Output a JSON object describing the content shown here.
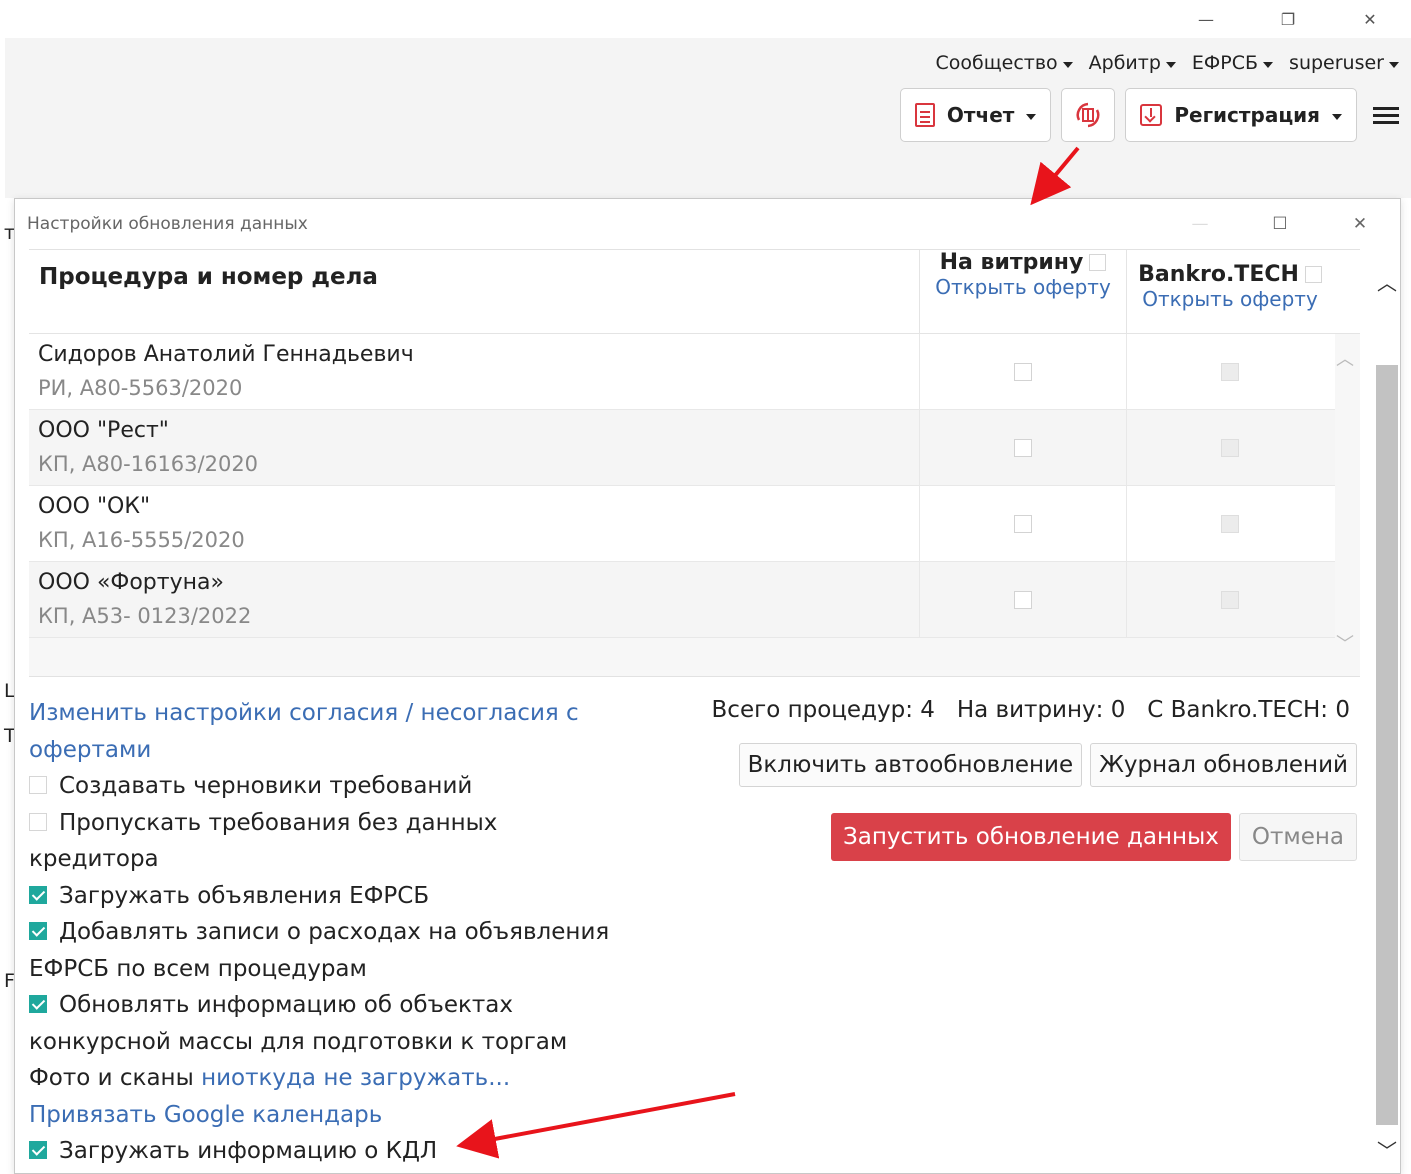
{
  "window_controls": {
    "minimize": "—",
    "restore": "❐",
    "close": "✕"
  },
  "topnav": [
    {
      "label": "Сообщество"
    },
    {
      "label": "Арбитр"
    },
    {
      "label": "ЕФРСБ"
    },
    {
      "label": "superuser"
    }
  ],
  "toolbar": {
    "report_label": "Отчет",
    "register_label": "Регистрация"
  },
  "left_fragments": [
    "т",
    "L",
    "T",
    "F"
  ],
  "dialog": {
    "title": "Настройки обновления данных",
    "controls": {
      "minimize": "—",
      "maximize": "☐",
      "close": "✕"
    },
    "table": {
      "col_name": "Процедура и номер дела",
      "col_showcase": "На витрину",
      "col_showcase_link": "Открыть оферту",
      "col_bankro": "Bankro.TECH",
      "col_bankro_link": "Открыть оферту",
      "rows": [
        {
          "name": "Сидоров Анатолий Геннадьевич",
          "sub": "РИ, А80-5563/2020"
        },
        {
          "name": "ООО \"Рест\"",
          "sub": "КП, А80-16163/2020"
        },
        {
          "name": "ООО \"ОК\"",
          "sub": "КП, А16-5555/2020"
        },
        {
          "name": "ООО «Фортуна»",
          "sub": "КП, А53- 0123/2022"
        }
      ]
    },
    "options": {
      "consent_link": "Изменить настройки согласия / несогласия с офертами",
      "create_drafts": "Создавать черновики требований",
      "skip_claims": "Пропускать требования без данных кредитора",
      "load_efrsb": "Загружать объявления ЕФРСБ",
      "add_expenses": "Добавлять записи о расходах на объявления ЕФРСБ по всем процедурам",
      "update_objects": "Обновлять информацию об объектах конкурсной массы для подготовки к торгам",
      "photos_prefix": "Фото и сканы",
      "photos_link": "ниоткуда не загружать...",
      "google_link": "Привязать Google календарь",
      "load_kdl": "Загружать информацию о КДЛ"
    },
    "summary": {
      "total_label": "Всего процедур:",
      "total_value": "4",
      "showcase_label": "На витрину:",
      "showcase_value": "0",
      "bankro_label": "С Bankro.TECH:",
      "bankro_value": "0"
    },
    "buttons": {
      "autoupdate": "Включить автообновление",
      "log": "Журнал обновлений",
      "run": "Запустить обновление данных",
      "cancel": "Отмена"
    }
  },
  "colors": {
    "accent_link": "#3b6db4",
    "run_button": "#d94149",
    "checkbox_checked": "#1fa89d",
    "arrow": "#e8141b"
  }
}
